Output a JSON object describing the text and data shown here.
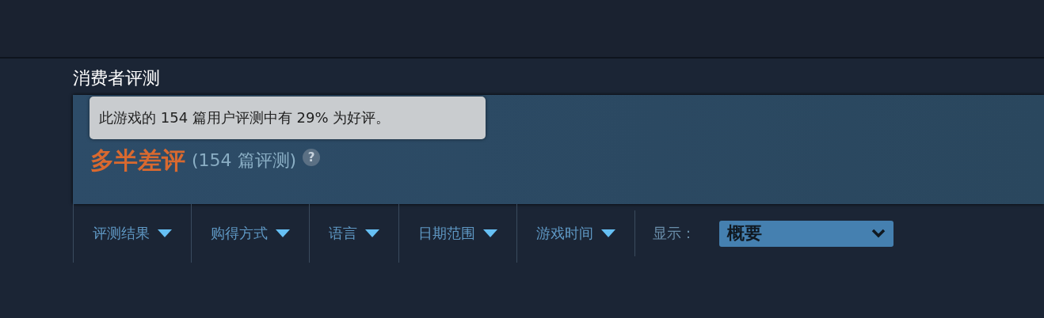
{
  "section": {
    "title": "消费者评测"
  },
  "summary": {
    "rating": "多半差评",
    "review_count": "(154 篇评测)",
    "help": "?",
    "tooltip": "此游戏的 154 篇用户评测中有 29% 为好评。"
  },
  "filters": [
    {
      "label": "评测结果"
    },
    {
      "label": "购得方式"
    },
    {
      "label": "语言"
    },
    {
      "label": "日期范围"
    },
    {
      "label": "游戏时间"
    }
  ],
  "display": {
    "label": "显示：",
    "value": "概要"
  }
}
